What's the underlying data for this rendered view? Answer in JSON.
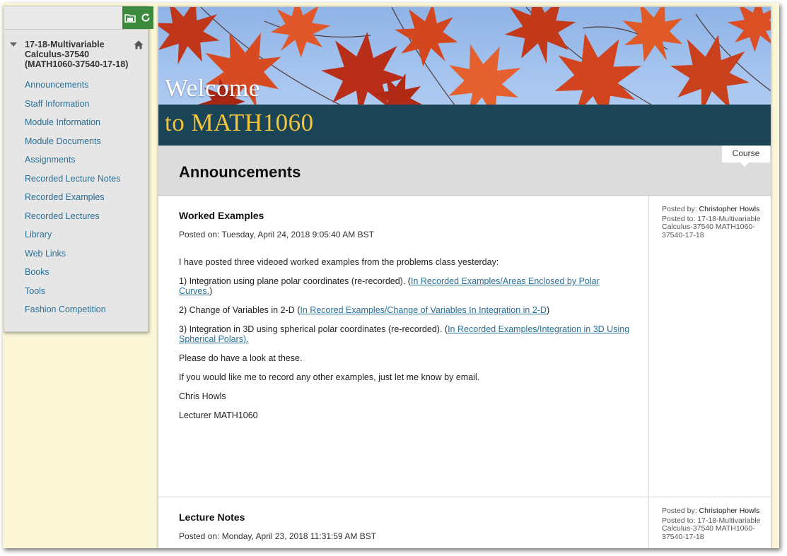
{
  "sidebar": {
    "search_placeholder": "",
    "course_title": "17-18-Multivariable Calculus-37540 (MATH1060-37540-17-18)",
    "items": [
      {
        "label": "Announcements"
      },
      {
        "label": "Staff Information"
      },
      {
        "label": "Module Information"
      },
      {
        "label": "Module Documents"
      },
      {
        "label": "Assignments"
      },
      {
        "label": "Recorded Lecture Notes"
      },
      {
        "label": "Recorded Examples"
      },
      {
        "label": "Recorded Lectures"
      },
      {
        "label": "Library"
      },
      {
        "label": "Web Links"
      },
      {
        "label": "Books"
      },
      {
        "label": "Tools"
      },
      {
        "label": "Fashion Competition"
      }
    ],
    "icons": {
      "folder": "folder-icon",
      "refresh": "refresh-icon",
      "home": "home-icon"
    }
  },
  "banner": {
    "line1": "Welcome",
    "line2": "to MATH1060"
  },
  "header": {
    "title": "Announcements",
    "course_tab": "Course"
  },
  "announcements": [
    {
      "title": "Worked Examples",
      "posted_on": "Posted on: Tuesday, April 24, 2018 9:05:40 AM BST",
      "intro": "I have posted three videoed worked examples from the problems class yesterday:",
      "item1_text": "1) Integration using plane polar coordinates (re-recorded).  (",
      "item1_link": "In Recorded Examples/Areas Enclosed by Polar Curves.",
      "item1_close": ")",
      "item2_text": "2) Change of Variables in 2-D (",
      "item2_link": "In Recored Examples/Change of Variables In Integration in 2-D",
      "item2_close": ")",
      "item3_text": "3) Integration in 3D using spherical polar coordinates (re-recorded). (",
      "item3_link": "In Recorded Examples/Integration in 3D Using Spherical Polars).",
      "outro1": "Please do have a look at these.",
      "outro2": "If you would like me to record any other examples, just let me know by email.",
      "sign1": "Chris Howls",
      "sign2": "Lecturer MATH1060",
      "posted_by_label": "Posted by: ",
      "posted_by": "Christopher Howls",
      "posted_to": "Posted to: 17-18-Multivariable Calculus-37540 MATH1060-37540-17-18"
    },
    {
      "title": "Lecture Notes",
      "posted_on": "Posted on: Monday, April 23, 2018 11:31:59 AM BST",
      "posted_by_label": "Posted by: ",
      "posted_by": "Christopher Howls",
      "posted_to": "Posted to: 17-18-Multivariable Calculus-37540 MATH1060-37540-17-18"
    }
  ],
  "colors": {
    "link": "#2a6f95",
    "tool_green": "#3c8a3c",
    "banner_strip": "#1b4456",
    "banner_gold": "#f2c53d",
    "page_bg": "#fbf7d6"
  }
}
